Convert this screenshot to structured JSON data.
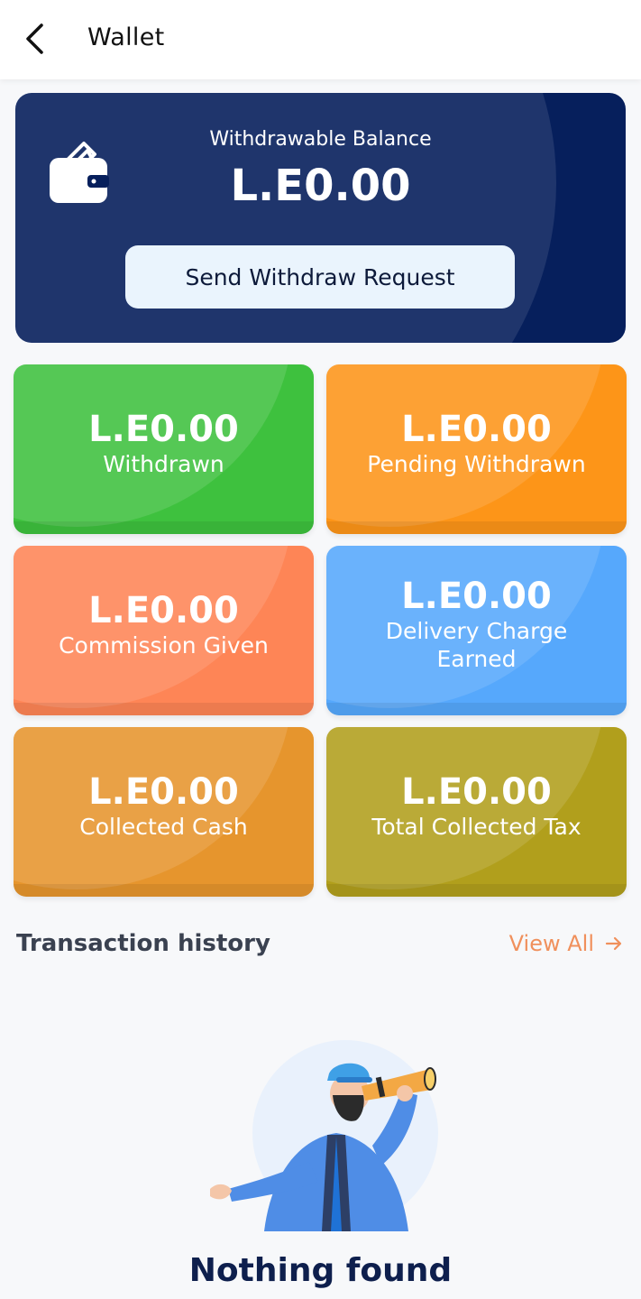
{
  "header": {
    "title": "Wallet",
    "back_icon": "back-arrow-icon"
  },
  "balance": {
    "label": "Withdrawable Balance",
    "amount": "L.E0.00",
    "button_label": "Send Withdraw Request",
    "icon": "wallet-icon"
  },
  "stats": [
    {
      "amount": "L.E0.00",
      "label": "Withdrawn",
      "color": "#3ec13e"
    },
    {
      "amount": "L.E0.00",
      "label": "Pending Withdrawn",
      "color": "#fd9518"
    },
    {
      "amount": "L.E0.00",
      "label": "Commission Given",
      "color": "#fe8556"
    },
    {
      "amount": "L.E0.00",
      "label": "Delivery Charge Earned",
      "color": "#56a8fc"
    },
    {
      "amount": "L.E0.00",
      "label": "Collected Cash",
      "color": "#e6952d"
    },
    {
      "amount": "L.E0.00",
      "label": "Total Collected Tax",
      "color": "#b19f1c"
    }
  ],
  "history": {
    "title": "Transaction history",
    "view_all_label": "View All",
    "view_all_icon": "arrow-right-icon"
  },
  "empty_state": {
    "title": "Nothing found",
    "illustration": "man-with-telescope-illustration"
  },
  "colors": {
    "balance_card": "#061f5c",
    "accent_link": "#f0905c",
    "empty_title": "#0e1f4d"
  }
}
